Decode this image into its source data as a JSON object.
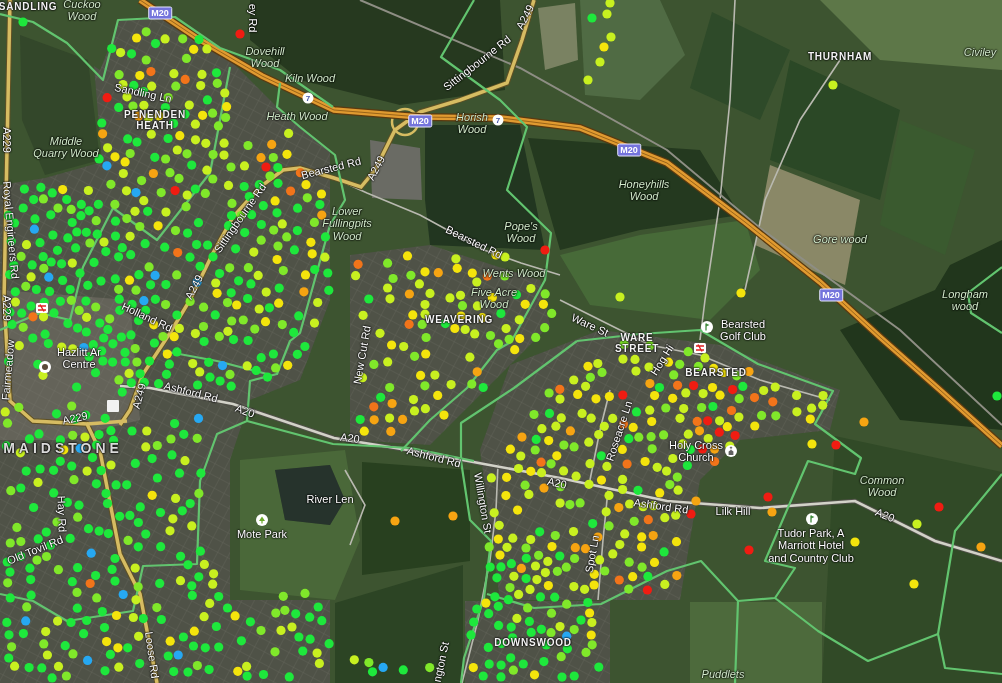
{
  "map": {
    "labels": [
      {
        "kind": "place",
        "lines": [
          "SANDLING"
        ]
      },
      {
        "kind": "wood",
        "lines": [
          "Cuckoo",
          "Wood"
        ]
      },
      {
        "kind": "shield",
        "lines": [
          "M20"
        ]
      },
      {
        "kind": "road",
        "lines": [
          "ey Rd"
        ]
      },
      {
        "kind": "road",
        "lines": [
          "A249"
        ]
      },
      {
        "kind": "wood",
        "lines": [
          "Dovehill",
          "Wood"
        ]
      },
      {
        "kind": "road",
        "lines": [
          "Sittingbourne Rd"
        ]
      },
      {
        "kind": "place",
        "lines": [
          "THURNHAM"
        ]
      },
      {
        "kind": "wood",
        "lines": [
          "Civiley"
        ]
      },
      {
        "kind": "wood",
        "lines": [
          "Kiln Wood"
        ]
      },
      {
        "kind": "road",
        "lines": [
          "Sandling Ln"
        ]
      },
      {
        "kind": "junction",
        "lines": [
          "7"
        ]
      },
      {
        "kind": "place",
        "lines": [
          "PENENDEN",
          "HEATH"
        ]
      },
      {
        "kind": "wood",
        "lines": [
          "Heath Wood"
        ]
      },
      {
        "kind": "shield",
        "lines": [
          "M20"
        ]
      },
      {
        "kind": "wood",
        "lines": [
          "Horish",
          "Wood"
        ]
      },
      {
        "kind": "junction",
        "lines": [
          "7"
        ]
      },
      {
        "kind": "road",
        "lines": [
          "A229"
        ]
      },
      {
        "kind": "wood",
        "lines": [
          "Middle",
          "Quarry Wood"
        ]
      },
      {
        "kind": "shield",
        "lines": [
          "M20"
        ]
      },
      {
        "kind": "road",
        "lines": [
          "Bearsted Rd"
        ]
      },
      {
        "kind": "road",
        "lines": [
          "A249"
        ]
      },
      {
        "kind": "wood",
        "lines": [
          "Honeyhills",
          "Wood"
        ]
      },
      {
        "kind": "road",
        "lines": [
          "Royal Engineers Rd"
        ]
      },
      {
        "kind": "road",
        "lines": [
          "Sittingbourne Rd"
        ]
      },
      {
        "kind": "wood",
        "lines": [
          "Lower",
          "Fullingpits",
          "Wood"
        ]
      },
      {
        "kind": "road",
        "lines": [
          "Bearsted Rd"
        ]
      },
      {
        "kind": "wood",
        "lines": [
          "Pope's",
          "Wood"
        ]
      },
      {
        "kind": "wood",
        "lines": [
          "Gore wood"
        ]
      },
      {
        "kind": "wood",
        "lines": [
          "Wents Wood"
        ]
      },
      {
        "kind": "road",
        "lines": [
          "A249"
        ]
      },
      {
        "kind": "wood",
        "lines": [
          "Five Acre",
          "Wood"
        ]
      },
      {
        "kind": "shield",
        "lines": [
          "M20"
        ]
      },
      {
        "kind": "wood",
        "lines": [
          "Longham",
          "wood"
        ]
      },
      {
        "kind": "road",
        "lines": [
          "A229"
        ]
      },
      {
        "kind": "road",
        "lines": [
          "Holland Rd"
        ]
      },
      {
        "kind": "place",
        "lines": [
          "WEAVERING"
        ]
      },
      {
        "kind": "road",
        "lines": [
          "Ware St"
        ]
      },
      {
        "kind": "poi",
        "lines": [
          "Bearsted",
          "Golf Club"
        ]
      },
      {
        "kind": "poi",
        "lines": [
          "Hazlitt Ar",
          "Centre"
        ]
      },
      {
        "kind": "road",
        "lines": [
          "New Cut Rd"
        ]
      },
      {
        "kind": "place",
        "lines": [
          "WARE",
          "STREET"
        ]
      },
      {
        "kind": "road",
        "lines": [
          "Hog Hi"
        ]
      },
      {
        "kind": "road",
        "lines": [
          "Fairmeadow"
        ]
      },
      {
        "kind": "place",
        "lines": [
          "BEARSTED"
        ]
      },
      {
        "kind": "road",
        "lines": [
          "A249"
        ]
      },
      {
        "kind": "road",
        "lines": [
          "Ashford Rd"
        ]
      },
      {
        "kind": "road",
        "lines": [
          "A229"
        ]
      },
      {
        "kind": "road",
        "lines": [
          "A20"
        ]
      },
      {
        "kind": "road",
        "lines": [
          "A20"
        ]
      },
      {
        "kind": "road",
        "lines": [
          "Roseacre Ln"
        ]
      },
      {
        "kind": "town",
        "lines": [
          "MAIDSTONE"
        ]
      },
      {
        "kind": "road",
        "lines": [
          "Ashford Rd"
        ]
      },
      {
        "kind": "poi",
        "lines": [
          "Holy Cross",
          "Church"
        ]
      },
      {
        "kind": "road",
        "lines": [
          "A20"
        ]
      },
      {
        "kind": "wood",
        "lines": [
          "Common",
          "Wood"
        ]
      },
      {
        "kind": "road",
        "lines": [
          "Hay Rd"
        ]
      },
      {
        "kind": "road",
        "lines": [
          "River Len"
        ]
      },
      {
        "kind": "road",
        "lines": [
          "Willington St"
        ]
      },
      {
        "kind": "road",
        "lines": [
          "Ashford Rd"
        ]
      },
      {
        "kind": "road",
        "lines": [
          "Lilk Hill"
        ]
      },
      {
        "kind": "road",
        "lines": [
          "A20"
        ]
      },
      {
        "kind": "road",
        "lines": [
          "Old Tovil Rd"
        ]
      },
      {
        "kind": "poi",
        "lines": [
          "Mote Park"
        ]
      },
      {
        "kind": "road",
        "lines": [
          "Spot Ln"
        ]
      },
      {
        "kind": "poi",
        "lines": [
          "Tudor Park, A",
          "Marriott Hotel",
          "and Country Club"
        ]
      },
      {
        "kind": "road",
        "lines": [
          "Loose Rd"
        ]
      },
      {
        "kind": "road",
        "lines": [
          "ngton St"
        ]
      },
      {
        "kind": "place",
        "lines": [
          "DOWNSWOOD"
        ]
      },
      {
        "kind": "wood",
        "lines": [
          "Puddlets"
        ]
      }
    ],
    "marker_series": [
      {
        "color": "#26a8f2"
      },
      {
        "color": "#1ee83c"
      },
      {
        "color": "#80e82a"
      },
      {
        "color": "#c8f020"
      },
      {
        "color": "#f4e40c"
      },
      {
        "color": "#f6a412"
      },
      {
        "color": "#f2741a"
      },
      {
        "color": "#f01c12"
      }
    ]
  }
}
